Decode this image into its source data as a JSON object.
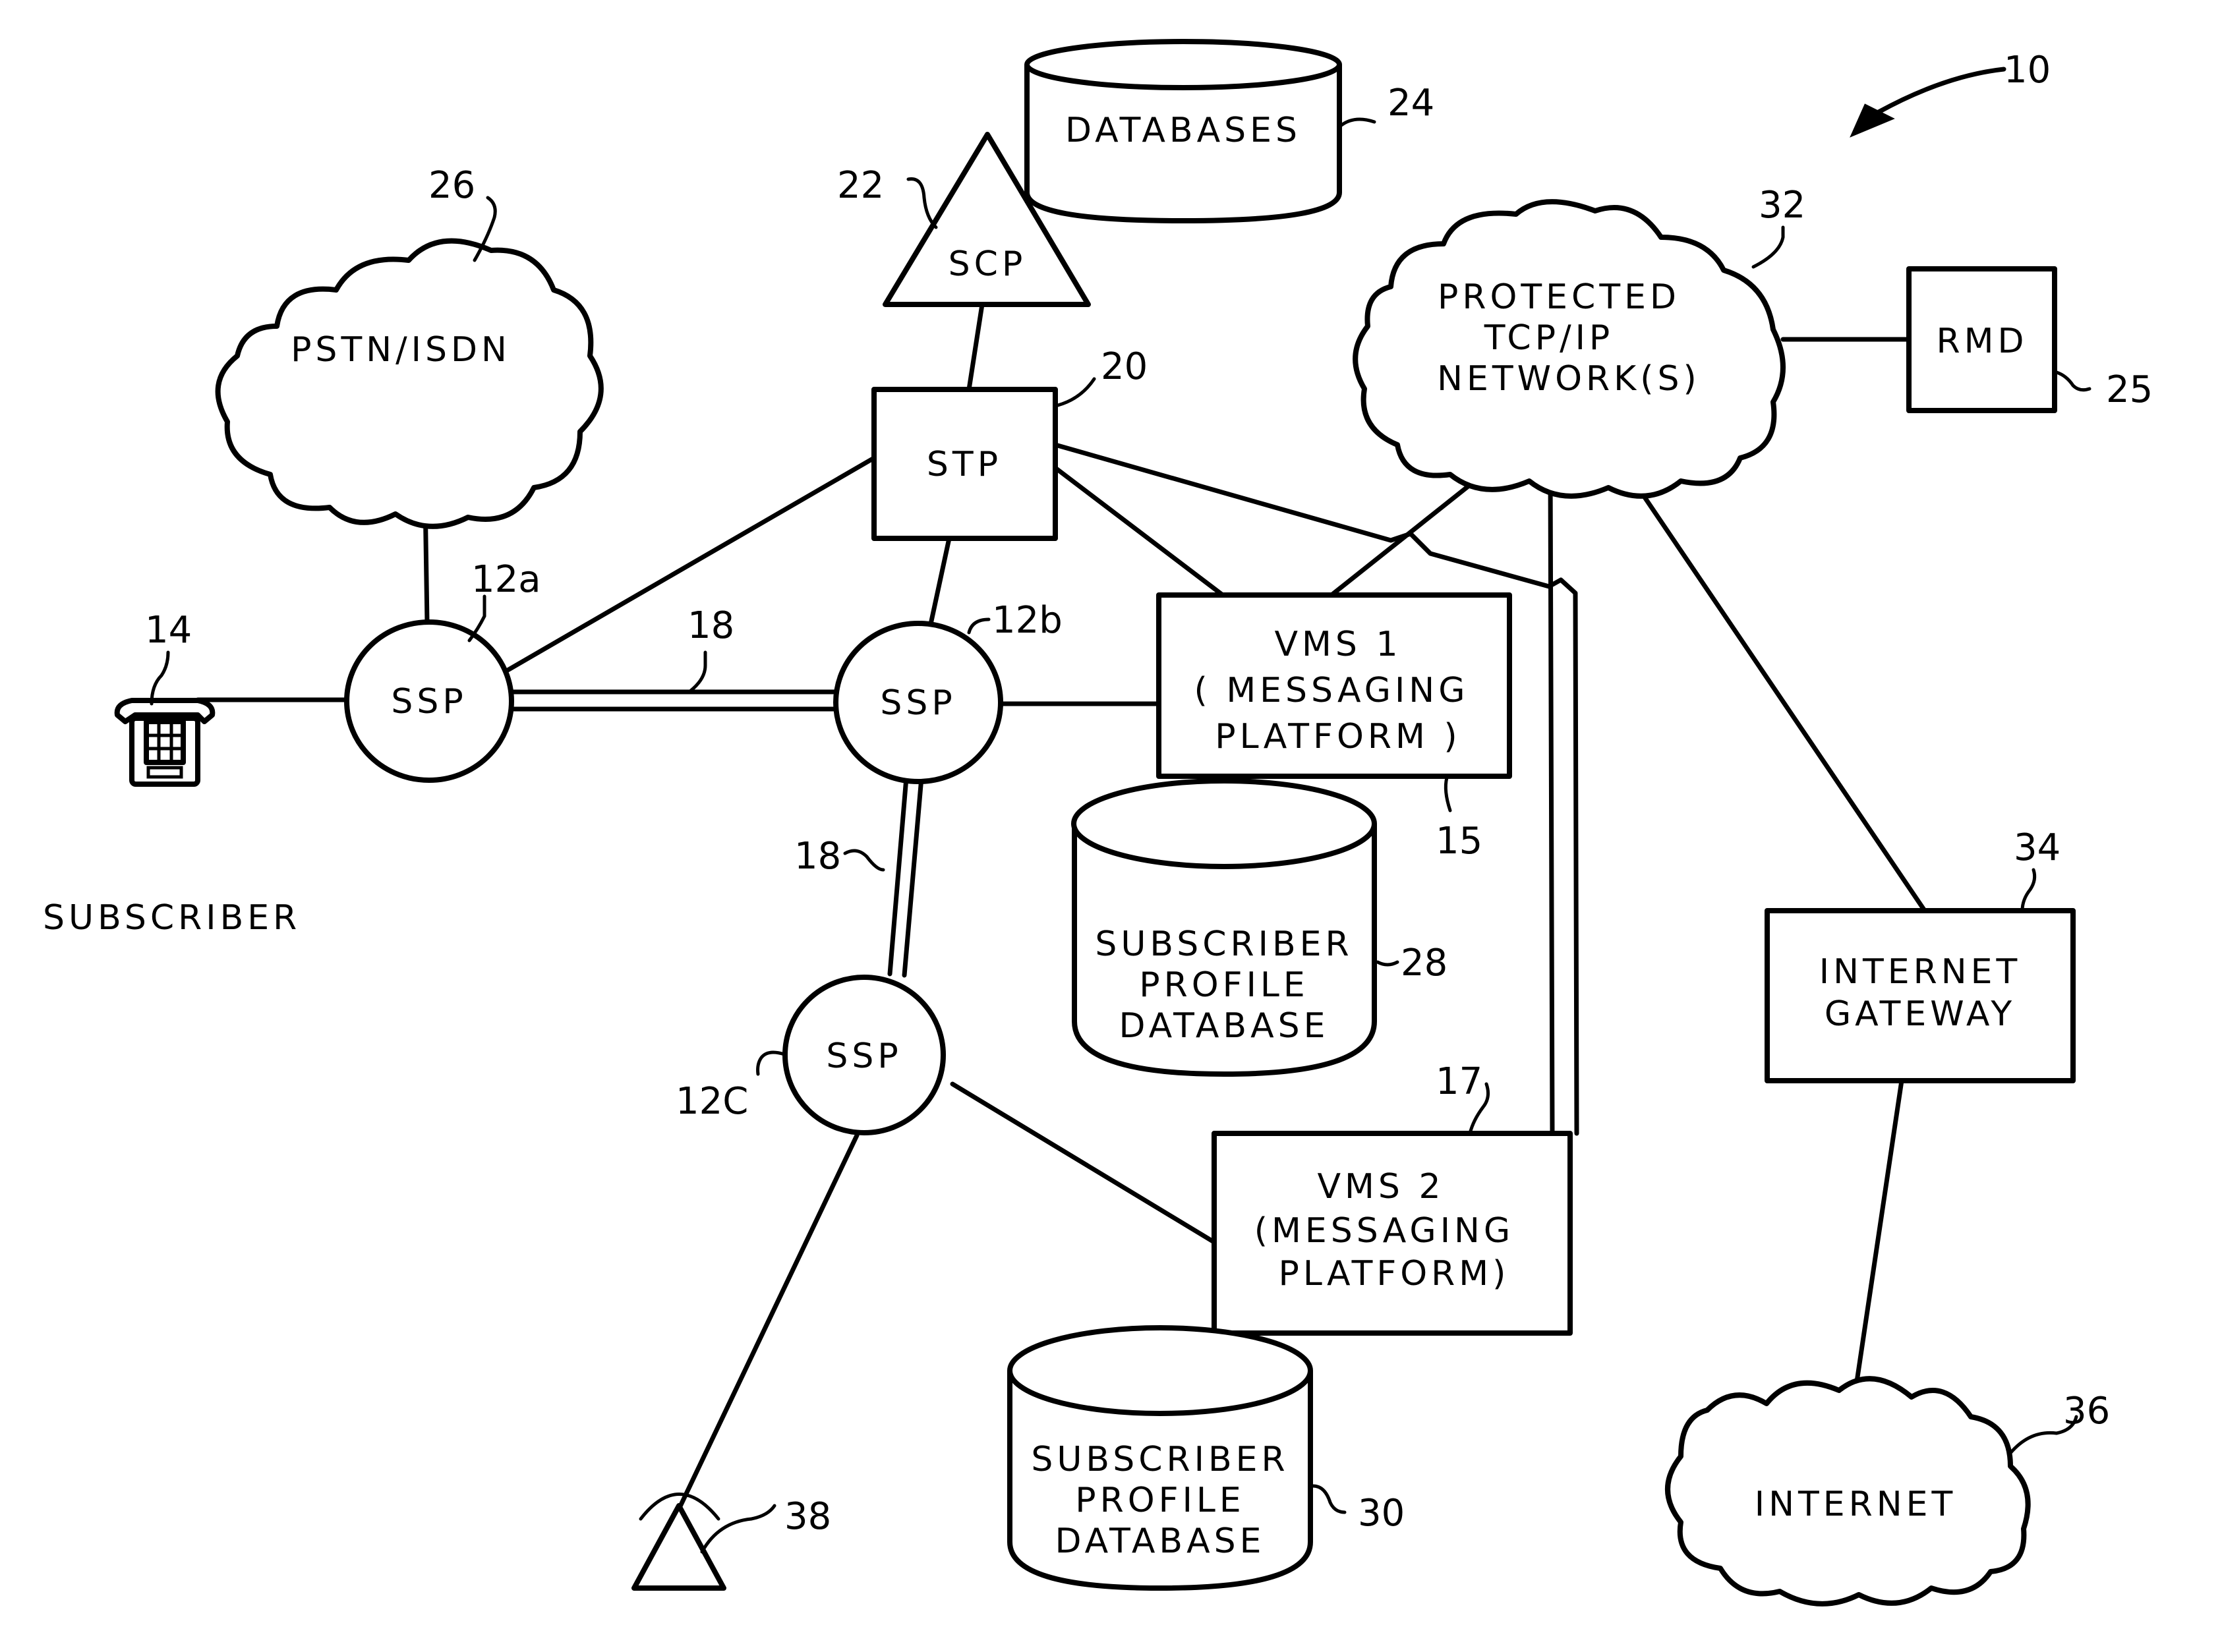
{
  "figure": {
    "ref": "10",
    "subscriber_label": "SUBSCRIBER"
  },
  "nodes": {
    "databases": {
      "label": "DATABASES",
      "ref": "24"
    },
    "scp": {
      "label": "SCP",
      "ref": "22"
    },
    "stp": {
      "label": "STP",
      "ref": "20"
    },
    "pstn": {
      "label": "PSTN/ISDN",
      "ref": "26"
    },
    "ssp_a": {
      "label": "SSP",
      "ref": "12a"
    },
    "ssp_b": {
      "label": "SSP",
      "ref": "12b"
    },
    "ssp_c": {
      "label": "SSP",
      "ref": "12C"
    },
    "phone": {
      "ref": "14"
    },
    "trunk_ab": {
      "ref": "18"
    },
    "trunk_bc": {
      "ref": "18"
    },
    "vms1": {
      "lines": [
        "VMS 1",
        "( MESSAGING",
        "PLATFORM )"
      ],
      "ref": "15"
    },
    "spdb1": {
      "lines": [
        "SUBSCRIBER",
        "PROFILE",
        "DATABASE"
      ],
      "ref": "28"
    },
    "vms2": {
      "lines": [
        "VMS 2",
        "(MESSAGING",
        "PLATFORM)"
      ],
      "ref": "17"
    },
    "spdb2": {
      "lines": [
        "SUBSCRIBER",
        "PROFILE",
        "DATABASE"
      ],
      "ref": "30"
    },
    "tcpip": {
      "lines": [
        "PROTECTED",
        "TCP/IP",
        "NETWORK(S)"
      ],
      "ref": "32"
    },
    "rmd": {
      "label": "RMD",
      "ref": "25"
    },
    "gateway": {
      "lines": [
        "INTERNET",
        "GATEWAY"
      ],
      "ref": "34"
    },
    "internet": {
      "label": "INTERNET",
      "ref": "36"
    },
    "antenna": {
      "ref": "38"
    }
  }
}
